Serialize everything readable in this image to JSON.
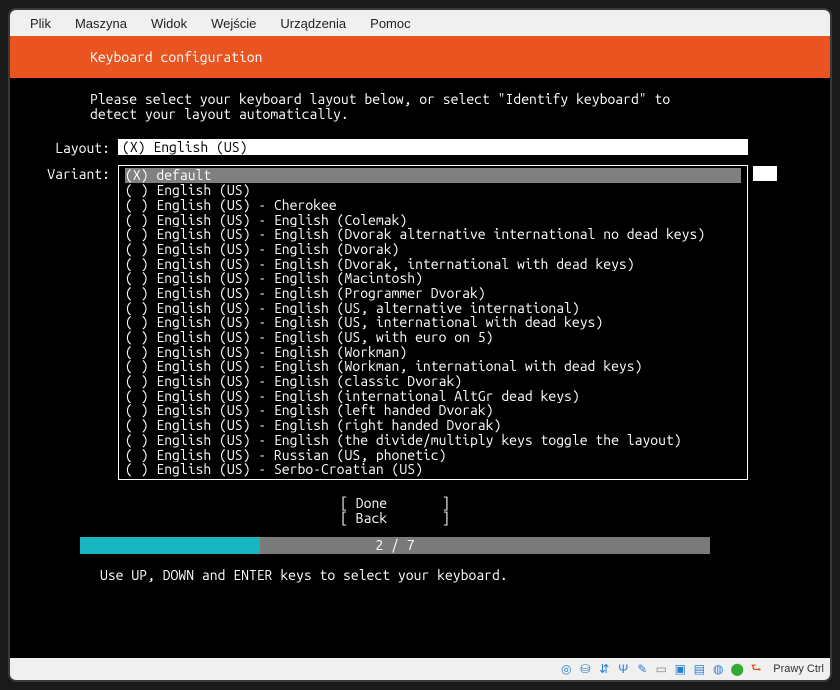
{
  "menu": {
    "items": [
      "Plik",
      "Maszyna",
      "Widok",
      "Wejście",
      "Urządzenia",
      "Pomoc"
    ]
  },
  "header": {
    "title": "Keyboard configuration"
  },
  "prompt": "Please select your keyboard layout below, or select \"Identify keyboard\" to\ndetect your layout automatically.",
  "labels": {
    "layout": "Layout:",
    "variant": "Variant:"
  },
  "layout": {
    "value": "(X) English (US)"
  },
  "variant": {
    "selected_index": 0,
    "options": [
      "(X) default",
      "( ) English (US)",
      "( ) English (US) - Cherokee",
      "( ) English (US) - English (Colemak)",
      "( ) English (US) - English (Dvorak alternative international no dead keys)",
      "( ) English (US) - English (Dvorak)",
      "( ) English (US) - English (Dvorak, international with dead keys)",
      "( ) English (US) - English (Macintosh)",
      "( ) English (US) - English (Programmer Dvorak)",
      "( ) English (US) - English (US, alternative international)",
      "( ) English (US) - English (US, international with dead keys)",
      "( ) English (US) - English (US, with euro on 5)",
      "( ) English (US) - English (Workman)",
      "( ) English (US) - English (Workman, international with dead keys)",
      "( ) English (US) - English (classic Dvorak)",
      "( ) English (US) - English (international AltGr dead keys)",
      "( ) English (US) - English (left handed Dvorak)",
      "( ) English (US) - English (right handed Dvorak)",
      "( ) English (US) - English (the divide/multiply keys toggle the layout)",
      "( ) English (US) - Russian (US, phonetic)",
      "( ) English (US) - Serbo-Croatian (US)"
    ]
  },
  "actions": {
    "done": "[ Done       ]",
    "back": "[ Back       ]"
  },
  "progress": {
    "current": 2,
    "total": 7,
    "text": "2 / 7",
    "percent": 28.57
  },
  "hint": "Use UP, DOWN and ENTER keys to select your keyboard.",
  "statusbar": {
    "host_key": "Prawy Ctrl",
    "icons": [
      "disc",
      "hdd",
      "net",
      "usb",
      "shared",
      "display",
      "record",
      "cam",
      "mic",
      "mouse",
      "key"
    ]
  },
  "colors": {
    "accent": "#e95420",
    "progress": "#19b6c0",
    "progress_bg": "#7a7a7a"
  }
}
